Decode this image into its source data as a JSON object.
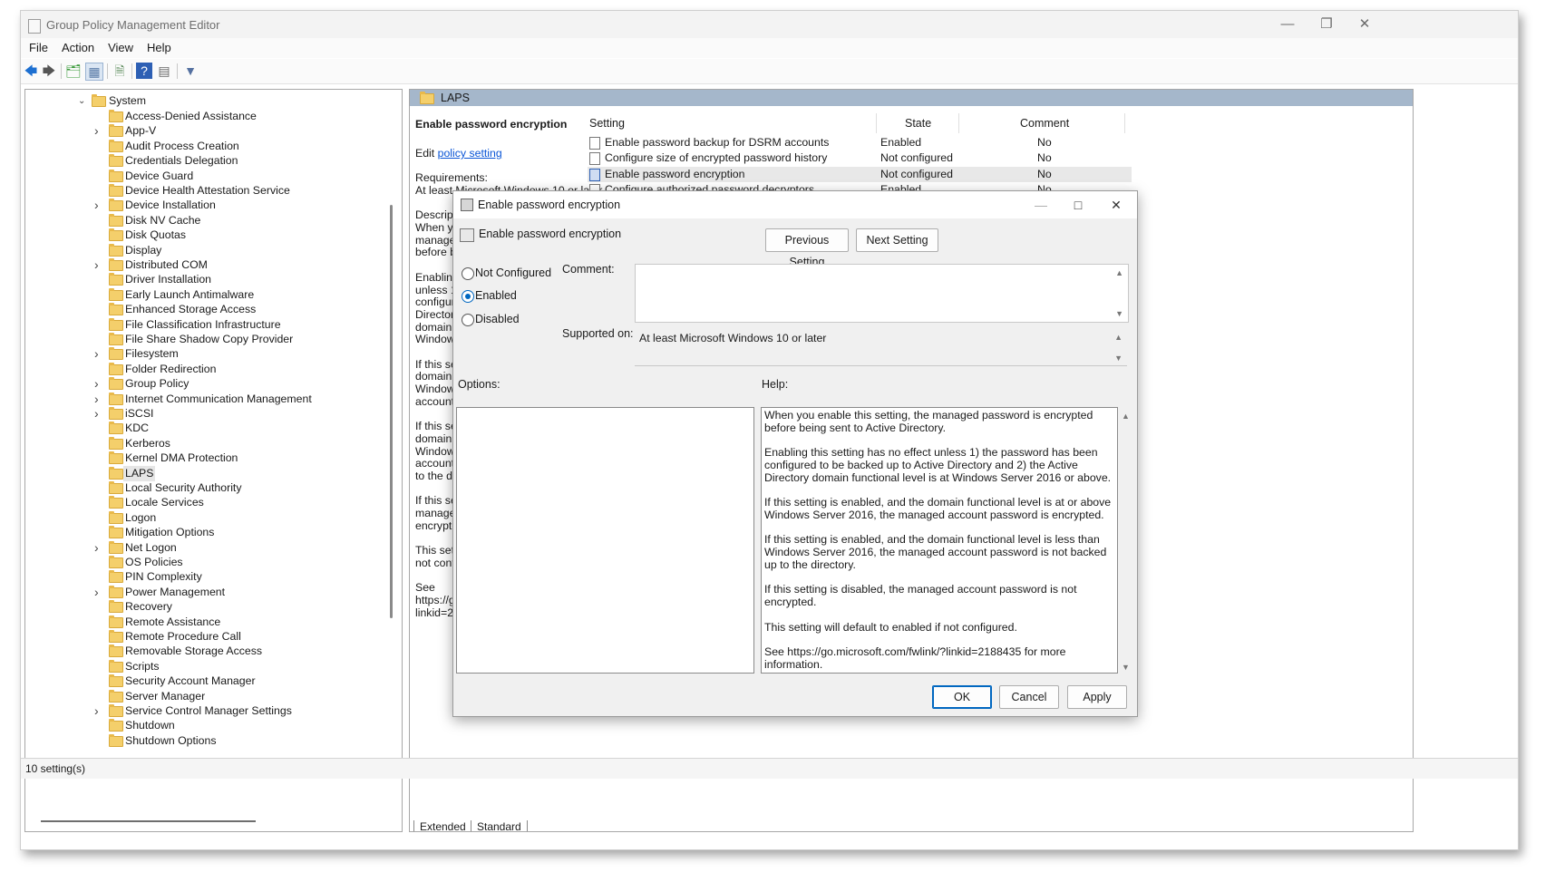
{
  "window": {
    "title": "Group Policy Management Editor"
  },
  "menu": [
    "File",
    "Action",
    "View",
    "Help"
  ],
  "tree": {
    "root": "System",
    "items": [
      {
        "label": "Access-Denied Assistance",
        "expandable": false
      },
      {
        "label": "App-V",
        "expandable": true
      },
      {
        "label": "Audit Process Creation",
        "expandable": false
      },
      {
        "label": "Credentials Delegation",
        "expandable": false
      },
      {
        "label": "Device Guard",
        "expandable": false
      },
      {
        "label": "Device Health Attestation Service",
        "expandable": false
      },
      {
        "label": "Device Installation",
        "expandable": true
      },
      {
        "label": "Disk NV Cache",
        "expandable": false
      },
      {
        "label": "Disk Quotas",
        "expandable": false
      },
      {
        "label": "Display",
        "expandable": false
      },
      {
        "label": "Distributed COM",
        "expandable": true
      },
      {
        "label": "Driver Installation",
        "expandable": false
      },
      {
        "label": "Early Launch Antimalware",
        "expandable": false
      },
      {
        "label": "Enhanced Storage Access",
        "expandable": false
      },
      {
        "label": "File Classification Infrastructure",
        "expandable": false
      },
      {
        "label": "File Share Shadow Copy Provider",
        "expandable": false
      },
      {
        "label": "Filesystem",
        "expandable": true
      },
      {
        "label": "Folder Redirection",
        "expandable": false
      },
      {
        "label": "Group Policy",
        "expandable": true
      },
      {
        "label": "Internet Communication Management",
        "expandable": true
      },
      {
        "label": "iSCSI",
        "expandable": true
      },
      {
        "label": "KDC",
        "expandable": false
      },
      {
        "label": "Kerberos",
        "expandable": false
      },
      {
        "label": "Kernel DMA Protection",
        "expandable": false
      },
      {
        "label": "LAPS",
        "expandable": false,
        "selected": true
      },
      {
        "label": "Local Security Authority",
        "expandable": false
      },
      {
        "label": "Locale Services",
        "expandable": false
      },
      {
        "label": "Logon",
        "expandable": false
      },
      {
        "label": "Mitigation Options",
        "expandable": false
      },
      {
        "label": "Net Logon",
        "expandable": true
      },
      {
        "label": "OS Policies",
        "expandable": false
      },
      {
        "label": "PIN Complexity",
        "expandable": false
      },
      {
        "label": "Power Management",
        "expandable": true
      },
      {
        "label": "Recovery",
        "expandable": false
      },
      {
        "label": "Remote Assistance",
        "expandable": false
      },
      {
        "label": "Remote Procedure Call",
        "expandable": false
      },
      {
        "label": "Removable Storage Access",
        "expandable": false
      },
      {
        "label": "Scripts",
        "expandable": false
      },
      {
        "label": "Security Account Manager",
        "expandable": false
      },
      {
        "label": "Server Manager",
        "expandable": false
      },
      {
        "label": "Service Control Manager Settings",
        "expandable": true
      },
      {
        "label": "Shutdown",
        "expandable": false
      },
      {
        "label": "Shutdown Options",
        "expandable": false
      }
    ]
  },
  "right": {
    "folder": "LAPS",
    "extended": {
      "title": "Enable password encryption",
      "edit_prefix": "Edit ",
      "edit_link": "policy setting ",
      "req_label": "Requirements:",
      "req_value": "At least Microsoft Windows 10 or later",
      "desc_label": "Description:",
      "lines": [
        "When you enable",
        "managed passwo",
        "before being sent",
        "",
        "Enabling this sett",
        "unless 1) the pass",
        "configured to be",
        "Directory and 2) t",
        "domain function",
        "Windows Server 2",
        "",
        "If this setting is er",
        "domain function",
        "Windows Server 2",
        "account passwor",
        "",
        "If this setting is er",
        "domain function",
        "Windows Server 2",
        "account passwor",
        "to the directory.",
        "",
        "If this setting is di",
        "managed accoun",
        "encrypted.",
        "",
        "This setting will d",
        "not configured.",
        "",
        "See",
        "https://go.micros",
        "linkid=2188435 fc"
      ]
    },
    "columns": {
      "setting": "Setting",
      "state": "State",
      "comment": "Comment"
    },
    "settings": [
      {
        "name": "Enable password backup for DSRM accounts",
        "state": "Enabled",
        "comment": "No"
      },
      {
        "name": "Configure size of encrypted password history",
        "state": "Not configured",
        "comment": "No"
      },
      {
        "name": "Enable password encryption",
        "state": "Not configured",
        "comment": "No",
        "selected": true
      },
      {
        "name": "Configure authorized password decryptors",
        "state": "Enabled",
        "comment": "No"
      }
    ],
    "tabs": [
      "Extended",
      "Standard"
    ]
  },
  "status": "10 setting(s)",
  "dialog": {
    "title": "Enable password encryption",
    "heading": "Enable password encryption",
    "prev_button": "Previous Setting",
    "next_button": "Next Setting",
    "options": [
      {
        "label": "Not Configured",
        "checked": false
      },
      {
        "label": "Enabled",
        "checked": true
      },
      {
        "label": "Disabled",
        "checked": false
      }
    ],
    "comment_label": "Comment:",
    "supported_label": "Supported on:",
    "supported_value": "At least Microsoft Windows 10 or later",
    "options_label": "Options:",
    "help_label": "Help:",
    "help_paragraphs": [
      "When you enable this setting, the managed password is encrypted before being sent to Active Directory.",
      "Enabling this setting has no effect unless 1) the password has been configured to be backed up to Active Directory and 2) the Active Directory domain functional level is at Windows Server 2016 or above.",
      "If this setting is enabled, and the domain functional level is at or above Windows Server 2016, the managed account password is encrypted.",
      "If this setting is enabled, and the domain functional level is less than Windows Server 2016, the managed account password is not backed up to the directory.",
      "If this setting is disabled, the managed account password is not encrypted.",
      "This setting will default to enabled if not configured.",
      "See https://go.microsoft.com/fwlink/?linkid=2188435 for more information."
    ],
    "ok": "OK",
    "cancel": "Cancel",
    "apply": "Apply"
  }
}
